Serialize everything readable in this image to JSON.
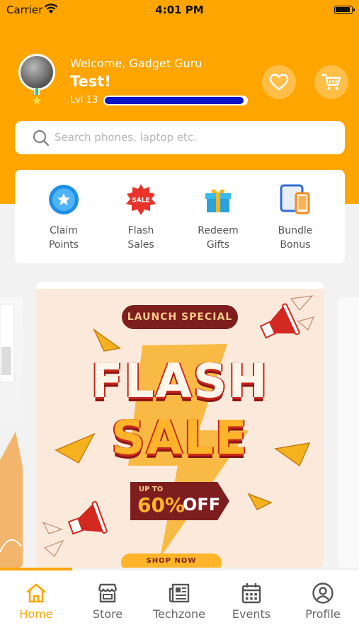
{
  "status_bar": {
    "carrier": "Carrier",
    "time": "4:01 PM"
  },
  "profile": {
    "welcome": "Welcome, Gadget Guru",
    "name": "Test!",
    "level": "Lvl 13",
    "xp_progress": 0.98
  },
  "header_actions": {
    "wishlist_icon": "heart-icon",
    "cart_icon": "cart-icon"
  },
  "search": {
    "placeholder": "Search phones, laptop etc."
  },
  "quick_actions": [
    {
      "label": "Claim\nPoints",
      "icon": "star-badge-icon"
    },
    {
      "label": "Flash\nSales",
      "icon": "sale-tag-icon"
    },
    {
      "label": "Redeem\nGifts",
      "icon": "gift-icon"
    },
    {
      "label": "Bundle\nBonus",
      "icon": "devices-icon"
    }
  ],
  "banner": {
    "tag": "LAUNCH SPECIAL",
    "line1": "FLASH",
    "line2": "SALE",
    "upto": "UP TO",
    "percent": "60%",
    "off": "OFF",
    "cta": "SHOP NOW"
  },
  "tabs": [
    {
      "label": "Home",
      "icon": "home-icon",
      "active": true
    },
    {
      "label": "Store",
      "icon": "store-icon",
      "active": false
    },
    {
      "label": "Techzone",
      "icon": "news-icon",
      "active": false
    },
    {
      "label": "Events",
      "icon": "calendar-icon",
      "active": false
    },
    {
      "label": "Profile",
      "icon": "profile-icon",
      "active": false
    }
  ],
  "colors": {
    "accent": "#FFA500",
    "xp_bar": "#0a14c8",
    "banner_maroon": "#7e1d1d"
  }
}
